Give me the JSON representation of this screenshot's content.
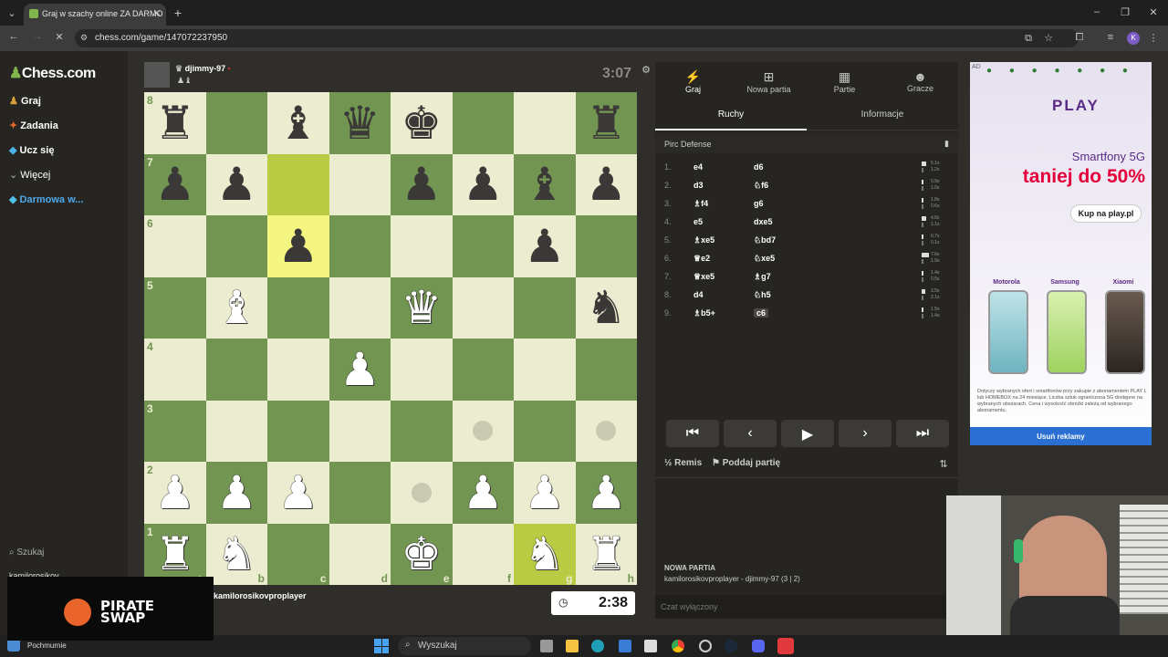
{
  "browser": {
    "tab_title": "Graj w szachy online ZA DARMO",
    "url": "chess.com/game/147072237950",
    "profile_initial": "K"
  },
  "leftnav": {
    "logo": "Chess.com",
    "items": [
      {
        "label": "Graj",
        "icon": "pawn-icon"
      },
      {
        "label": "Zadania",
        "icon": "puzzle-icon"
      },
      {
        "label": "Ucz się",
        "icon": "cap-icon"
      },
      {
        "label": "Więcej",
        "icon": "chevron-down-icon"
      },
      {
        "label": "Darmowa w...",
        "icon": "diamond-icon"
      }
    ],
    "search_label": "Szukaj",
    "user_label": "kamilorosikov..."
  },
  "top_player": {
    "name": "djimmy-97",
    "clock": "3:07"
  },
  "bottom_player": {
    "name": "kamilorosikovproplayer",
    "clock": "2:38"
  },
  "board": {
    "ranks": [
      "8",
      "7",
      "6",
      "5",
      "4",
      "3",
      "2",
      "1"
    ],
    "files": [
      "a",
      "b",
      "c",
      "d",
      "e",
      "f",
      "g",
      "h"
    ],
    "position": [
      [
        "bR",
        "",
        "bB",
        "bQ",
        "bK",
        "",
        "",
        "bR"
      ],
      [
        "bP",
        "bP",
        "",
        "",
        "bP",
        "bP",
        "bB",
        "bP"
      ],
      [
        "",
        "",
        "bP",
        "",
        "",
        "",
        "bP",
        ""
      ],
      [
        "",
        "wB",
        "",
        "",
        "wQ",
        "",
        "",
        "bN"
      ],
      [
        "",
        "",
        "",
        "wP",
        "",
        "",
        "",
        ""
      ],
      [
        "",
        "",
        "",
        "",
        "",
        "dot",
        "",
        "dot"
      ],
      [
        "wP",
        "wP",
        "wP",
        "",
        "dot",
        "wP",
        "wP",
        "wP"
      ],
      [
        "wR",
        "wN",
        "",
        "",
        "wK",
        "",
        "wN",
        "wR"
      ]
    ],
    "highlights": [
      "c7",
      "c6",
      "g1"
    ]
  },
  "panel": {
    "tabs": [
      "Graj",
      "Nowa partia",
      "Partie",
      "Gracze"
    ],
    "subtabs": [
      "Ruchy",
      "Informacje"
    ],
    "opening": "Pirc Defense",
    "moves": [
      {
        "n": "1.",
        "w": "e4",
        "b": "d6"
      },
      {
        "n": "2.",
        "w": "d3",
        "b": "♘f6"
      },
      {
        "n": "3.",
        "w": "♗f4",
        "b": "g6"
      },
      {
        "n": "4.",
        "w": "e5",
        "b": "dxe5"
      },
      {
        "n": "5.",
        "w": "♗xe5",
        "b": "♘bd7"
      },
      {
        "n": "6.",
        "w": "♕e2",
        "b": "♘xe5"
      },
      {
        "n": "7.",
        "w": "♕xe5",
        "b": "♗g7"
      },
      {
        "n": "8.",
        "w": "d4",
        "b": "♘h5"
      },
      {
        "n": "9.",
        "w": "♗b5+",
        "b": "c6"
      }
    ],
    "times": [
      [
        "5.1s",
        "1.2s"
      ],
      [
        "0.9s",
        "1.0s"
      ],
      [
        "1.8s",
        "0.6s"
      ],
      [
        "4.8s",
        "1.1s"
      ],
      [
        "0.7s",
        "0.1s"
      ],
      [
        "7.6s",
        "1.9s"
      ],
      [
        "1.4s",
        "0.5s"
      ],
      [
        "3.5s",
        "2.1s"
      ],
      [
        "1.5s",
        "1.4s"
      ]
    ],
    "draw_label": "Remis",
    "resign_label": "Poddaj partię",
    "new_game_title": "NOWA PARTIA",
    "new_game_players": "kamilorosikovproplayer - djimmy-97 (3 | 2)",
    "chat_placeholder": "Czat wyłączony"
  },
  "ad": {
    "brand": "PLAY",
    "line1": "Smartfony 5G",
    "line2": "taniej do 50%",
    "cta": "Kup na play.pl",
    "phones": [
      "Motorola",
      "Samsung",
      "Xiaomi"
    ],
    "fine_print": "Dotyczy wybranych ofert i smartfonów przy zakupie z abonamentem PLAY L lub HOMEBOX na 24 miesiące. Liczba sztuk ograniczona 5G dostępne na wybranych obszarach. Cena i wysokość obniżki zależą od wybranego abonamentu.",
    "remove": "Usuń reklamy",
    "badge": "AD"
  },
  "overlay": {
    "brand": "PIRATE SWAP"
  },
  "taskbar": {
    "search": "Wyszukaj",
    "weather": "Pochmurnie"
  },
  "colors": {
    "light_square": "#ebecd0",
    "dark_square": "#739552",
    "highlight": "#f5f682",
    "ad_accent": "#e4003a",
    "ad_brand": "#5b2a86"
  }
}
